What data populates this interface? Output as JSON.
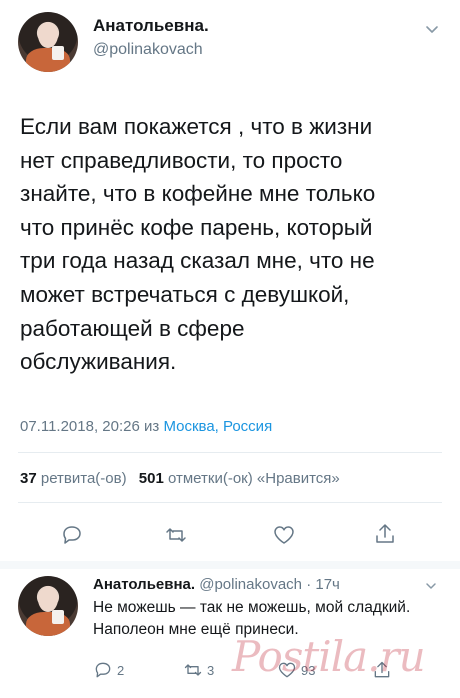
{
  "tweet": {
    "author_name": "Анатольевна.",
    "author_handle": "@polinakovach",
    "text": "Если вам покажется , что в жизни\nнет справедливости, то просто\nзнайте, что в кофейне мне только\nчто принёс кофе парень, который\nтри года назад сказал мне, что не\nможет встречаться с девушкой,\nработающей в сфере\nобслуживания.",
    "timestamp": "07.11.2018, 20:26",
    "from_word": "из",
    "location": "Москва, Россия",
    "retweets_count": "37",
    "retweets_label": "ретвита(-ов)",
    "likes_count": "501",
    "likes_label": "отметки(-ок) «Нравится»"
  },
  "reply": {
    "author_name": "Анатольевна.",
    "author_handle_time": "@polinakovach · 17ч",
    "text": "Не можешь — так не можешь, мой сладкий. Наполеон мне ещё принеси.",
    "reply_count": "2",
    "retweet_count": "3",
    "like_count": "93"
  },
  "watermark": "Postila.ru",
  "colors": {
    "text": "#14171a",
    "secondary": "#657786",
    "link": "#1b95e0",
    "divider": "#e6ecf0"
  }
}
